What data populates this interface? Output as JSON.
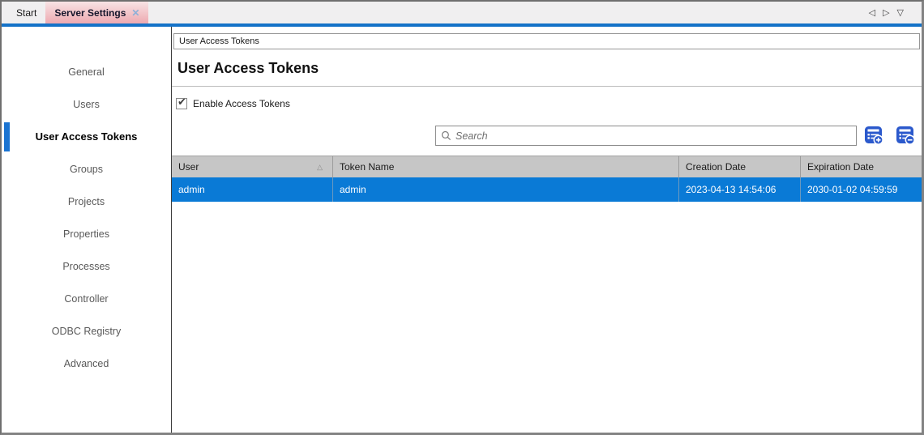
{
  "tab_bar": {
    "tabs": [
      {
        "label": "Start"
      },
      {
        "label": "Server Settings",
        "close_glyph": "✕"
      }
    ],
    "nav": {
      "back_glyph": "◁",
      "forward_glyph": "▷",
      "menu_glyph": "▽"
    }
  },
  "sidebar": {
    "items": [
      {
        "label": "General"
      },
      {
        "label": "Users"
      },
      {
        "label": "User Access Tokens",
        "selected": true
      },
      {
        "label": "Groups"
      },
      {
        "label": "Projects"
      },
      {
        "label": "Properties"
      },
      {
        "label": "Processes"
      },
      {
        "label": "Controller"
      },
      {
        "label": "ODBC Registry"
      },
      {
        "label": "Advanced"
      }
    ]
  },
  "main": {
    "breadcrumb": "User Access Tokens",
    "title": "User Access Tokens",
    "checkbox": {
      "label": "Enable Access Tokens",
      "checked": true,
      "glyph": "✔"
    },
    "search": {
      "placeholder": "Search",
      "icon": "magnifier-icon"
    },
    "toolbar": {
      "buttons": [
        {
          "icon": "add-token-icon"
        },
        {
          "icon": "remove-token-icon"
        }
      ]
    },
    "table": {
      "columns": [
        {
          "label": "User",
          "sort": "asc",
          "sort_glyph": "△"
        },
        {
          "label": "Token Name"
        },
        {
          "label": "Creation Date"
        },
        {
          "label": "Expiration Date"
        }
      ],
      "rows": [
        {
          "selected": true,
          "cells": [
            "admin",
            "admin",
            "2023-04-13 14:54:06",
            "2030-01-02 04:59:59"
          ]
        }
      ]
    }
  },
  "colors": {
    "accent_blue": "#1472c8",
    "selection_blue": "#0a7ad6",
    "active_tab_pink": "#eda9b0",
    "table_header_gray": "#c6c6c6",
    "toolbar_icon_blue": "#2b59cc",
    "sidebar_accent_blue": "#1b74d2"
  }
}
